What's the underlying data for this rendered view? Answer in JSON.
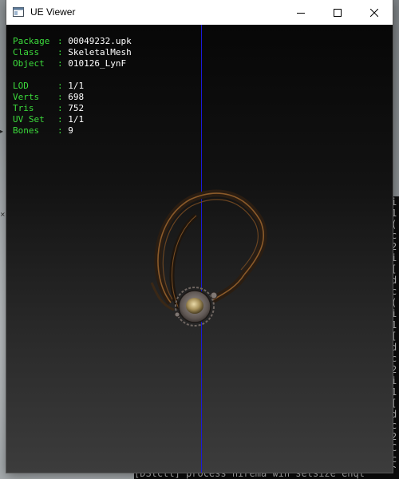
{
  "window": {
    "title": "UE Viewer"
  },
  "info_panel": {
    "rows": [
      {
        "label": "Package",
        "value": "00049232.upk"
      },
      {
        "label": "Class",
        "value": "SkeletalMesh"
      },
      {
        "label": "Object",
        "value": "010126_LynF"
      },
      {
        "label": "LOD",
        "value": "1/1"
      },
      {
        "label": "Verts",
        "value": "698"
      },
      {
        "label": "Tris",
        "value": "752"
      },
      {
        "label": "UV Set",
        "value": "1/1"
      },
      {
        "label": "Bones",
        "value": "9"
      }
    ],
    "separator": ":"
  },
  "background_console": {
    "lines": [
      "i",
      "1",
      "(",
      "c",
      "2",
      "i",
      "[",
      "d",
      "c",
      "(",
      "i",
      "1",
      "[",
      "d",
      "c",
      "2",
      "i",
      "1",
      "[",
      "d",
      "c",
      "2",
      "C",
      "c",
      "2"
    ],
    "bottom_line": "[DStctl] process  nirema win setsize  enqt"
  },
  "colors": {
    "label_green": "#3cdc3c",
    "value_white": "#ffffff",
    "axis_blue": "#1a1ad8",
    "viewport_bg": "#1a1a1a"
  },
  "icons": {
    "app": "ue-viewer-app-icon",
    "minimize": "minimize-icon",
    "maximize": "maximize-icon",
    "close": "close-icon"
  }
}
